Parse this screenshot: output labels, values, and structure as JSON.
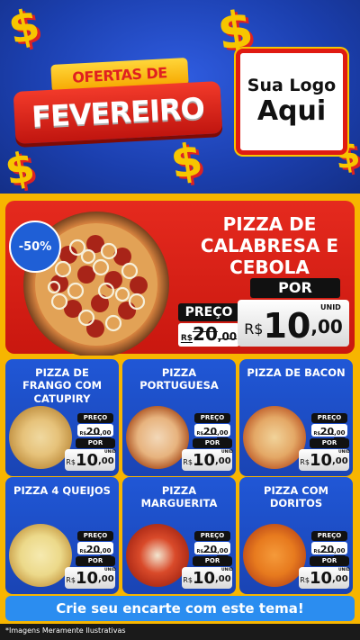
{
  "header": {
    "banner_top": "OFERTAS DE",
    "banner_main": "FEVEREIRO",
    "logo_line1": "Sua Logo",
    "logo_line2": "Aqui"
  },
  "featured": {
    "discount": "-50%",
    "title": "PIZZA DE CALABRESA E CEBOLA",
    "preco_label": "PREÇO",
    "old_price_prefix": "R$",
    "old_price_int": "20",
    "old_price_dec": ",00",
    "por_label": "POR",
    "unid": "UNID",
    "new_price_prefix": "R$",
    "new_price_int": "10",
    "new_price_dec": ",00"
  },
  "cards": [
    {
      "title": "PIZZA DE FRANGO COM CATUPIRY",
      "preco_label": "PREÇO",
      "old_prefix": "R$",
      "old_int": "20",
      "old_dec": ",00",
      "por_label": "POR",
      "unid": "UNID",
      "new_prefix": "R$",
      "new_int": "10",
      "new_dec": ",00"
    },
    {
      "title": "PIZZA PORTUGUESA",
      "preco_label": "PREÇO",
      "old_prefix": "R$",
      "old_int": "20",
      "old_dec": ",00",
      "por_label": "POR",
      "unid": "UNID",
      "new_prefix": "R$",
      "new_int": "10",
      "new_dec": ",00"
    },
    {
      "title": "PIZZA DE BACON",
      "preco_label": "PREÇO",
      "old_prefix": "R$",
      "old_int": "20",
      "old_dec": ",00",
      "por_label": "POR",
      "unid": "UNID",
      "new_prefix": "R$",
      "new_int": "10",
      "new_dec": ",00"
    },
    {
      "title": "PIZZA 4 QUEIJOS",
      "preco_label": "PREÇO",
      "old_prefix": "R$",
      "old_int": "20",
      "old_dec": ",00",
      "por_label": "POR",
      "unid": "UNID",
      "new_prefix": "R$",
      "new_int": "10",
      "new_dec": ",00"
    },
    {
      "title": "PIZZA MARGUERITA",
      "preco_label": "PREÇO",
      "old_prefix": "R$",
      "old_int": "20",
      "old_dec": ",00",
      "por_label": "POR",
      "unid": "UNID",
      "new_prefix": "R$",
      "new_int": "10",
      "new_dec": ",00"
    },
    {
      "title": "PIZZA COM DORITOS",
      "preco_label": "PREÇO",
      "old_prefix": "R$",
      "old_int": "20",
      "old_dec": ",00",
      "por_label": "POR",
      "unid": "UNID",
      "new_prefix": "R$",
      "new_int": "10",
      "new_dec": ",00"
    }
  ],
  "footer": {
    "cta": "Crie seu encarte com este tema!",
    "disclaimer": "*Imagens Meramente Ilustrativas"
  },
  "colors": {
    "blue_bg": "#1a3fa8",
    "red": "#e01b12",
    "yellow": "#f7b500",
    "cta_blue": "#2b8df0"
  }
}
